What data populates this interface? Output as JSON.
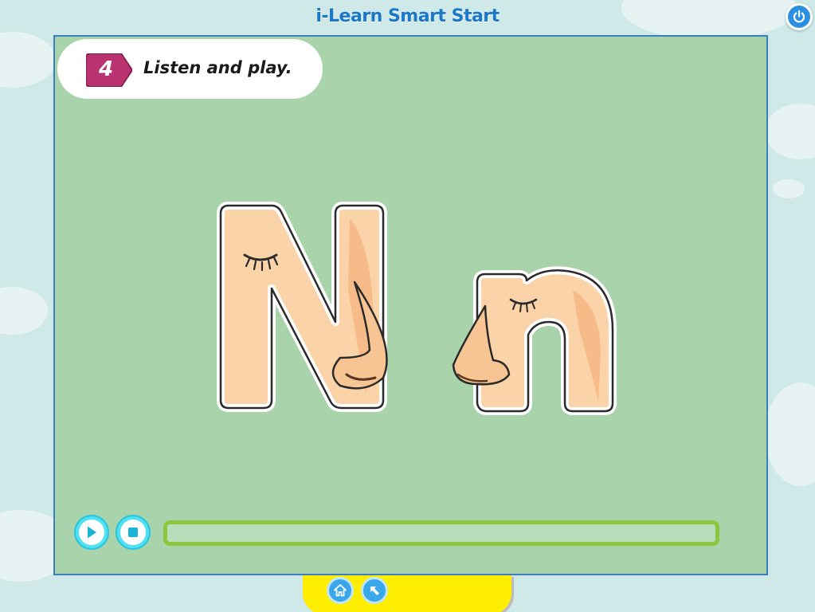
{
  "app": {
    "title": "i-Learn Smart Start"
  },
  "instruction": {
    "number": "4",
    "text": "Listen and play."
  },
  "letters": {
    "uppercase": "N",
    "lowercase": "n"
  },
  "player": {
    "progress": 0
  },
  "icons": {
    "power": "power-icon",
    "play": "play-icon",
    "stop": "stop-icon",
    "home": "home-icon",
    "back": "back-arrow-icon"
  },
  "colors": {
    "stage_bg": "#a9d4ab",
    "badge": "#b83370",
    "accent_blue": "#1b78c9",
    "progress_green": "#8cc63f",
    "button_cyan": "#53e0f2",
    "bottom_bar": "#ffee00"
  }
}
